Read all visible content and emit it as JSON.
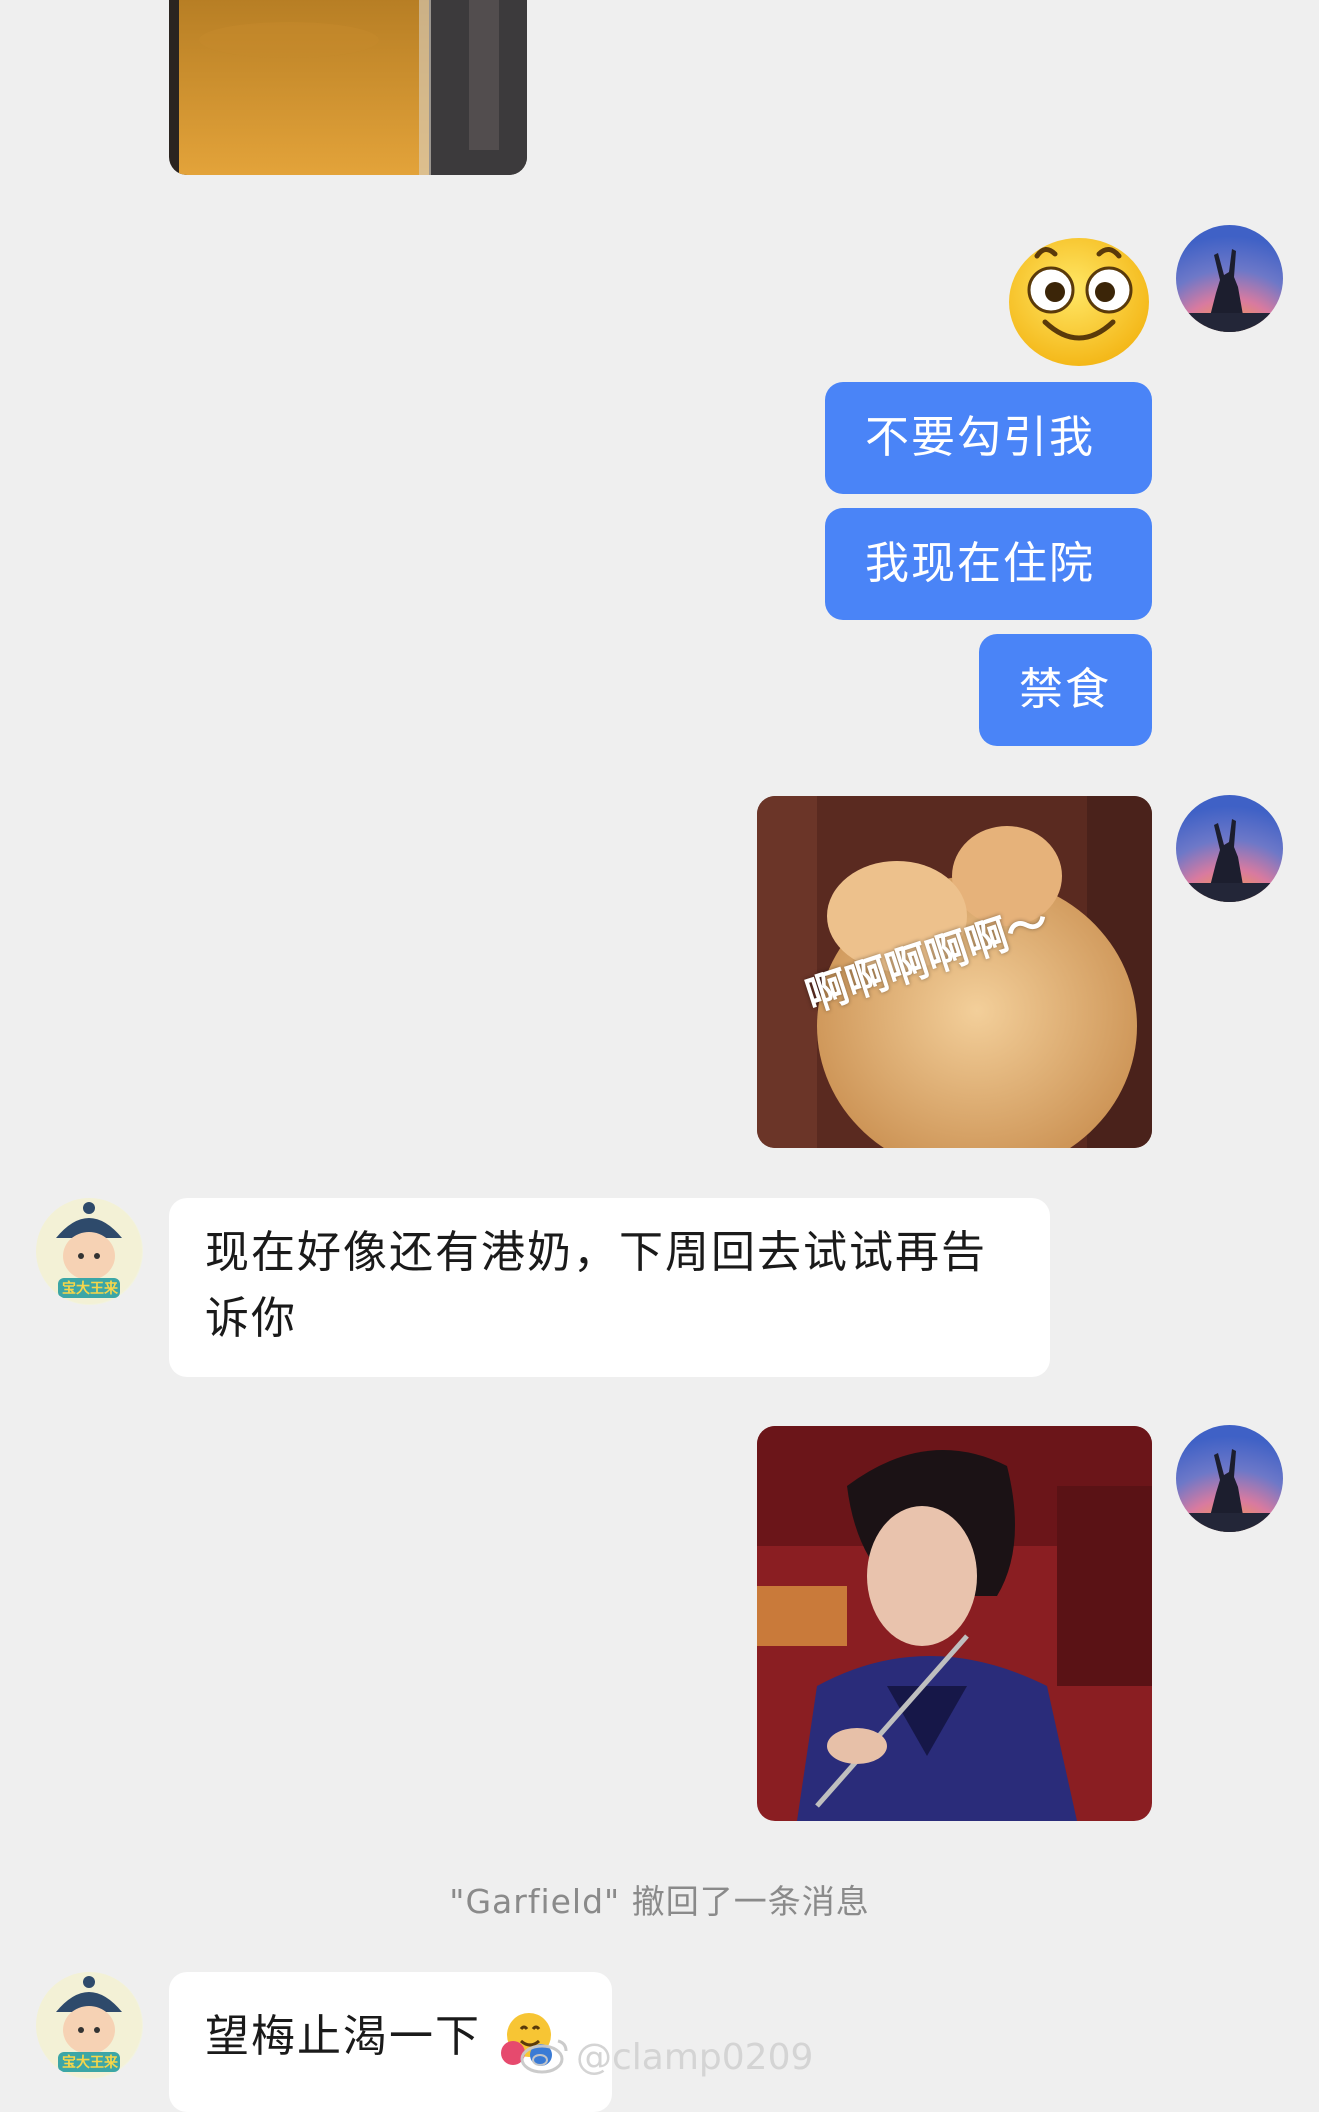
{
  "messages": {
    "m1_text": "不要勾引我",
    "m2_text": "我现在住院",
    "m3_text": "禁食",
    "m4_sticker_caption": "啊啊啊啊啊～",
    "m5_text": "现在好像还有港奶，下周回去试试再告诉你",
    "m6_text": "望梅止渴一下"
  },
  "system_notice": "\"Garfield\" 撤回了一条消息",
  "avatar_badge_text": "宝大王来",
  "watermark": "@clamp0209",
  "colors": {
    "outgoing_bubble": "#4a84f7",
    "incoming_bubble": "#ffffff",
    "background": "#efefef"
  },
  "icons": {
    "big_emoji": "wide-eyed-smile-emoji",
    "hug_emoji": "hugging-face-emoji",
    "watermark_logo": "weibo-logo"
  }
}
